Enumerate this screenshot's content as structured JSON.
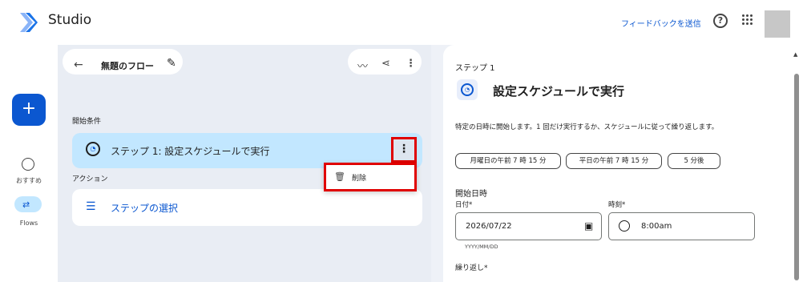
{
  "header": {
    "app_title": "Studio",
    "feedback_link": "フィードバックを送信",
    "help_icon": "help-icon",
    "help_glyph": "?",
    "apps_icon": "apps-grid-icon",
    "brand_color": "#0b57d0"
  },
  "rail": {
    "create_icon": "+",
    "items": [
      {
        "label": "おすすめ",
        "icon": "explore-icon"
      },
      {
        "label": "Flows",
        "icon": "flows-icon",
        "glyph": "⇄"
      }
    ]
  },
  "editor": {
    "back_icon": "←",
    "flow_title": "無題のフロー",
    "edit_icon": "✎",
    "toolbar_icons": {
      "activity": "〰",
      "share": "⋖",
      "more": "⋮"
    },
    "trigger_section": "開始条件",
    "trigger_step": {
      "icon": "◔",
      "label": "ステップ 1: 設定スケジュールで実行",
      "kebab": "⋮"
    },
    "context_menu": {
      "delete_icon": "🗑",
      "delete_label": "削除"
    },
    "action_section": "アクション",
    "action_step": {
      "icon": "☰",
      "label": "ステップの選択"
    }
  },
  "detail": {
    "step_label": "ステップ 1",
    "icon_glyph": "◔",
    "title": "設定スケジュールで実行",
    "description": "特定の日時に開始します。1 回だけ実行するか、スケジュールに従って繰り返します。",
    "chips": [
      "月曜日の午前 7 時 15 分",
      "平日の午前 7 時 15 分",
      "5 分後"
    ],
    "start_heading": "開始日時",
    "date_label": "日付*",
    "date_value": "2026/07/22",
    "date_hint": "YYYY/MM/DD",
    "calendar_icon": "▣",
    "time_label": "時刻*",
    "time_value": "8:00am",
    "repeat_label": "繰り返し*",
    "scroll_up": "▲"
  }
}
